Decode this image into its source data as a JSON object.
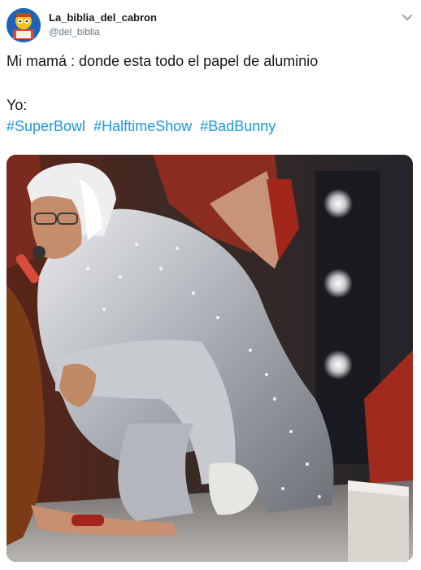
{
  "header": {
    "display_name": "La_biblia_del_cabron",
    "handle": "@del_biblia",
    "avatar_icon": "cartoon-reader-avatar",
    "menu_icon": "chevron-down-icon"
  },
  "tweet": {
    "line1": "Mi mamá : donde esta todo el papel de aluminio",
    "line2": "Yo:",
    "hashtags": [
      "#SuperBowl",
      "#HalftimeShow",
      "#BadBunny"
    ]
  },
  "media": {
    "type": "photo",
    "subject": "performer in silver foil outfit kneeling on stage"
  },
  "colors": {
    "link": "#1b95e0",
    "text": "#14171a",
    "secondary": "#657786"
  }
}
